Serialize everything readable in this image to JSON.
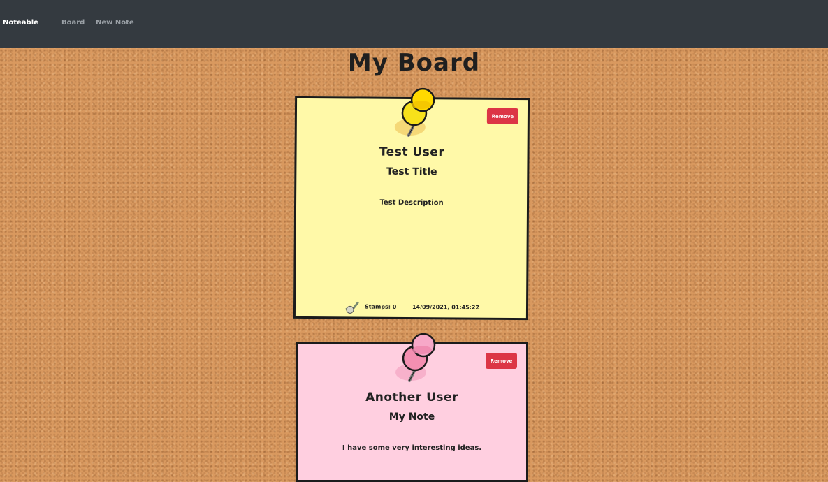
{
  "navbar": {
    "brand": "Noteable",
    "links": [
      {
        "label": "Board"
      },
      {
        "label": "New Note"
      }
    ]
  },
  "page": {
    "title": "My Board"
  },
  "notes": [
    {
      "color": "#fff9a8",
      "pin_color": "#f7e11b",
      "user": "Test User",
      "title": "Test Title",
      "description": "Test Description",
      "remove_label": "Remove",
      "stamps_label": "Stamps: 0",
      "timestamp": "14/09/2021, 01:45:22"
    },
    {
      "color": "#ffcfe0",
      "pin_color": "#f48fb1",
      "user": "Another User",
      "title": "My Note",
      "description": "I have some very interesting ideas.",
      "remove_label": "Remove"
    }
  ],
  "icons": {
    "pin": "pushpin-icon",
    "stamp": "stamp-icon"
  }
}
